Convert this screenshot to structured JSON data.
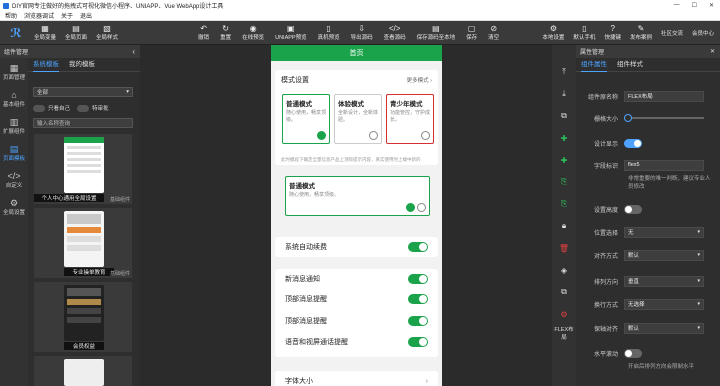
{
  "window": {
    "title": "DIY官网专注做好的拖拽式可视化微信小程序、UNIAPP、Vue WebApp设计工具",
    "controls": [
      "—",
      "☐",
      "✕"
    ]
  },
  "menu": [
    "帮助",
    "浏览器调试",
    "关于",
    "退出"
  ],
  "toolbar": {
    "left": [
      {
        "label": "全局变量",
        "icon": "▦"
      },
      {
        "label": "全局页面",
        "icon": "▤"
      },
      {
        "label": "全局样式",
        "icon": "▧"
      }
    ],
    "center": [
      {
        "label": "撤销",
        "icon": "↶"
      },
      {
        "label": "重置",
        "icon": "↻"
      },
      {
        "label": "在线预览",
        "icon": "◉"
      },
      {
        "label": "UNIAPP预览",
        "icon": "▣"
      },
      {
        "label": "真机预览",
        "icon": "▯"
      },
      {
        "label": "导出源码",
        "icon": "⇩"
      },
      {
        "label": "查看源码",
        "icon": "</>"
      },
      {
        "label": "保存源码至本地",
        "icon": "▤"
      },
      {
        "label": "保存",
        "icon": "▢"
      },
      {
        "label": "清空",
        "icon": "⊘"
      }
    ],
    "right": [
      {
        "label": "本地设置",
        "icon": "⚙"
      },
      {
        "label": "默认手机",
        "icon": "▯"
      },
      {
        "label": "快捷键",
        "icon": "?"
      },
      {
        "label": "发布案例",
        "icon": "✎"
      },
      {
        "label": "社区交流",
        "icon": ""
      },
      {
        "label": "会员中心",
        "icon": ""
      }
    ]
  },
  "leftnav": {
    "header": "组件管理",
    "items": [
      {
        "label": "页面管理",
        "icon": "▦"
      },
      {
        "label": "基本组件",
        "icon": "⌂"
      },
      {
        "label": "扩展组件",
        "icon": "▥"
      },
      {
        "label": "页面模板",
        "icon": "▤"
      },
      {
        "label": "自定义",
        "icon": "</>"
      },
      {
        "label": "全局设置",
        "icon": "⚙"
      }
    ],
    "tabs": [
      "系统模板",
      "我的模板"
    ],
    "filter_select": "全部",
    "only_mine": "只看自己",
    "pinned": "特审批",
    "search_placeholder": "输入名称查询",
    "templates": [
      {
        "name": "个人中心通用全局设置",
        "tag": "基础组件"
      },
      {
        "name": "专业操单教育",
        "tag": "基础组件"
      },
      {
        "name": "会员权益",
        "tag": ""
      }
    ]
  },
  "mobile": {
    "title": "首页",
    "mode_section": {
      "title": "模式设置",
      "more": "更多模式 ›"
    },
    "modes": [
      {
        "title": "普通模式",
        "desc": "随心使用，畅享顶级。",
        "checked": true
      },
      {
        "title": "体验模式",
        "desc": "全新设计，全新体验。",
        "checked": false
      },
      {
        "title": "青少年模式",
        "desc": "功能管控，守护成长。",
        "checked": false
      }
    ],
    "notice": "此时模段下确定全量信息产品上顶际提示内容，真实使用时上端中新的",
    "mode_bottom": {
      "title": "普通模式",
      "desc": "随心使用，畅享顶级。"
    },
    "auto_renew": "系统自动续费",
    "switches": [
      "新消息通知",
      "顶部消息提醒",
      "顶部消息提醒",
      "语音和视屏通话提醒"
    ],
    "font_size": "字体大小"
  },
  "rightnav": {
    "flex_label": "FLEX布局"
  },
  "rightpanel": {
    "header": "属性管理",
    "tabs": [
      "组件属性",
      "组件样式"
    ],
    "props": [
      {
        "label": "组件原名称",
        "value": "FLEX布局",
        "type": "input"
      },
      {
        "label": "栅格大小",
        "value": "",
        "type": "slider"
      },
      {
        "label": "设计显示",
        "value": "",
        "type": "toggle-on"
      },
      {
        "label": "字段标识",
        "value": "flex5",
        "type": "input"
      },
      {
        "label": "",
        "value": "非常重要的唯一判断，建议专业人员修改",
        "type": "note"
      },
      {
        "label": "设置高度",
        "value": "",
        "type": "toggle"
      },
      {
        "label": "位置选择",
        "value": "无",
        "type": "select"
      },
      {
        "label": "对齐方式",
        "value": "默认",
        "type": "select"
      },
      {
        "label": "排列方向",
        "value": "垂直",
        "type": "select"
      },
      {
        "label": "换行方式",
        "value": "无选择",
        "type": "select"
      },
      {
        "label": "保轴对齐",
        "value": "默认",
        "type": "select"
      },
      {
        "label": "水平滚动",
        "value": "",
        "type": "toggle"
      },
      {
        "label": "",
        "value": "开启后排列方向会限制水平",
        "type": "note"
      }
    ]
  }
}
